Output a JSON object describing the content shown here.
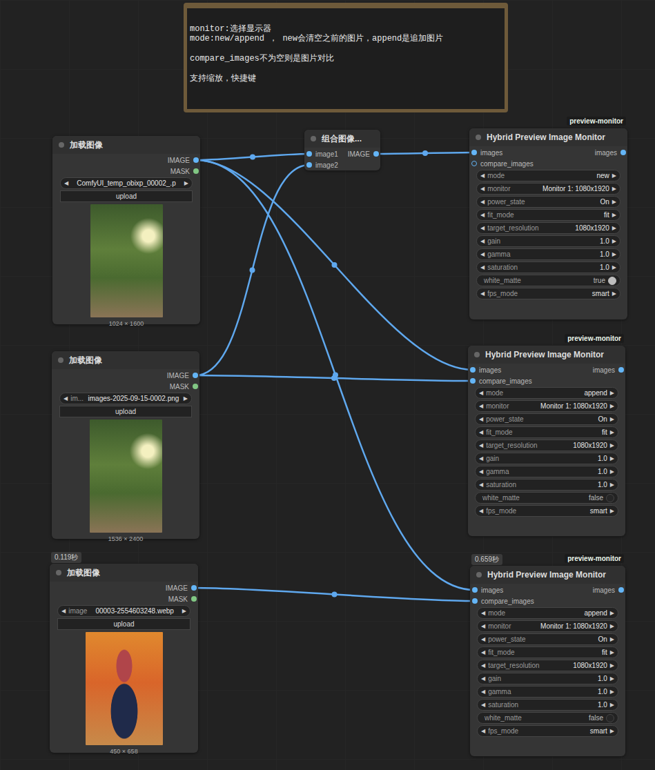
{
  "note": {
    "lines": [
      "monitor:选择显示器",
      "mode:new/append ， new会清空之前的图片，append是追加图片",
      "",
      "compare_images不为空则是图片对比",
      "",
      "支持缩放，快捷键"
    ]
  },
  "widget_arrows": {
    "left": "◀",
    "right": "▶"
  },
  "nodes": [
    {
      "kind": "load",
      "title": "加载图像",
      "inputs": [],
      "outputs": [
        {
          "name": "IMAGE",
          "type": "IMAGE"
        },
        {
          "name": "MASK",
          "type": "MASK"
        }
      ],
      "file": {
        "value": "ComfyUI_temp_obixp_00002_.p"
      },
      "button": "upload",
      "image_size": "1024 × 1600"
    },
    {
      "kind": "load",
      "title": "加载图像",
      "inputs": [],
      "outputs": [
        {
          "name": "IMAGE",
          "type": "IMAGE"
        },
        {
          "name": "MASK",
          "type": "MASK"
        }
      ],
      "file": {
        "label": "im...",
        "value": "images-2025-09-15-0002.png"
      },
      "button": "upload",
      "image_size": "1536 × 2400"
    },
    {
      "kind": "load",
      "title": "加载图像",
      "time": "0.119秒",
      "inputs": [],
      "outputs": [
        {
          "name": "IMAGE",
          "type": "IMAGE"
        },
        {
          "name": "MASK",
          "type": "MASK"
        }
      ],
      "file": {
        "label": "image",
        "value": "00003-2554603248.webp"
      },
      "button": "upload",
      "image_size": "450 × 658"
    },
    {
      "kind": "combine",
      "title": "组合图像...",
      "inputs": [
        {
          "name": "image1",
          "type": "IMAGE",
          "from": {
            "node": 0,
            "slot": 0
          }
        },
        {
          "name": "image2",
          "type": "IMAGE",
          "from": {
            "node": 1,
            "slot": 0
          }
        }
      ],
      "outputs": [
        {
          "name": "IMAGE",
          "type": "IMAGE"
        }
      ]
    },
    {
      "kind": "monitor",
      "badge": "preview-monitor",
      "title": "Hybrid Preview Image Monitor",
      "inputs": [
        {
          "name": "images",
          "type": "IMAGE",
          "from": {
            "node": 3,
            "slot": 0
          }
        },
        {
          "name": "compare_images",
          "type": "IMAGE"
        }
      ],
      "outputs": [
        {
          "name": "images",
          "type": "IMAGE"
        }
      ],
      "widgets": [
        {
          "kind": "combo",
          "label": "mode",
          "value": "new"
        },
        {
          "kind": "combo",
          "label": "monitor",
          "value": "Monitor 1: 1080x1920"
        },
        {
          "kind": "combo",
          "label": "power_state",
          "value": "On"
        },
        {
          "kind": "combo",
          "label": "fit_mode",
          "value": "fit"
        },
        {
          "kind": "combo",
          "label": "target_resolution",
          "value": "1080x1920"
        },
        {
          "kind": "number",
          "label": "gain",
          "value": "1.0"
        },
        {
          "kind": "number",
          "label": "gamma",
          "value": "1.0"
        },
        {
          "kind": "number",
          "label": "saturation",
          "value": "1.0"
        },
        {
          "kind": "toggle",
          "label": "white_matte",
          "value": "true",
          "on": true
        },
        {
          "kind": "combo",
          "label": "fps_mode",
          "value": "smart"
        }
      ]
    },
    {
      "kind": "monitor",
      "badge": "preview-monitor",
      "title": "Hybrid Preview Image Monitor",
      "inputs": [
        {
          "name": "images",
          "type": "IMAGE",
          "from": {
            "node": 0,
            "slot": 0
          }
        },
        {
          "name": "compare_images",
          "type": "IMAGE",
          "from": {
            "node": 1,
            "slot": 0
          }
        }
      ],
      "outputs": [
        {
          "name": "images",
          "type": "IMAGE"
        }
      ],
      "widgets": [
        {
          "kind": "combo",
          "label": "mode",
          "value": "append"
        },
        {
          "kind": "combo",
          "label": "monitor",
          "value": "Monitor 1: 1080x1920"
        },
        {
          "kind": "combo",
          "label": "power_state",
          "value": "On"
        },
        {
          "kind": "combo",
          "label": "fit_mode",
          "value": "fit"
        },
        {
          "kind": "combo",
          "label": "target_resolution",
          "value": "1080x1920"
        },
        {
          "kind": "number",
          "label": "gain",
          "value": "1.0"
        },
        {
          "kind": "number",
          "label": "gamma",
          "value": "1.0"
        },
        {
          "kind": "number",
          "label": "saturation",
          "value": "1.0"
        },
        {
          "kind": "toggle",
          "label": "white_matte",
          "value": "false",
          "on": false
        },
        {
          "kind": "combo",
          "label": "fps_mode",
          "value": "smart"
        }
      ]
    },
    {
      "kind": "monitor",
      "badge": "preview-monitor",
      "time": "0.659秒",
      "title": "Hybrid Preview Image Monitor",
      "inputs": [
        {
          "name": "images",
          "type": "IMAGE",
          "from": {
            "node": 0,
            "slot": 0
          }
        },
        {
          "name": "compare_images",
          "type": "IMAGE",
          "from": {
            "node": 2,
            "slot": 0
          }
        }
      ],
      "outputs": [
        {
          "name": "images",
          "type": "IMAGE"
        }
      ],
      "widgets": [
        {
          "kind": "combo",
          "label": "mode",
          "value": "append"
        },
        {
          "kind": "combo",
          "label": "monitor",
          "value": "Monitor 1: 1080x1920"
        },
        {
          "kind": "combo",
          "label": "power_state",
          "value": "On"
        },
        {
          "kind": "combo",
          "label": "fit_mode",
          "value": "fit"
        },
        {
          "kind": "combo",
          "label": "target_resolution",
          "value": "1080x1920"
        },
        {
          "kind": "number",
          "label": "gain",
          "value": "1.0"
        },
        {
          "kind": "number",
          "label": "gamma",
          "value": "1.0"
        },
        {
          "kind": "number",
          "label": "saturation",
          "value": "1.0"
        },
        {
          "kind": "toggle",
          "label": "white_matte",
          "value": "false",
          "on": false
        },
        {
          "kind": "combo",
          "label": "fps_mode",
          "value": "smart"
        }
      ]
    }
  ]
}
